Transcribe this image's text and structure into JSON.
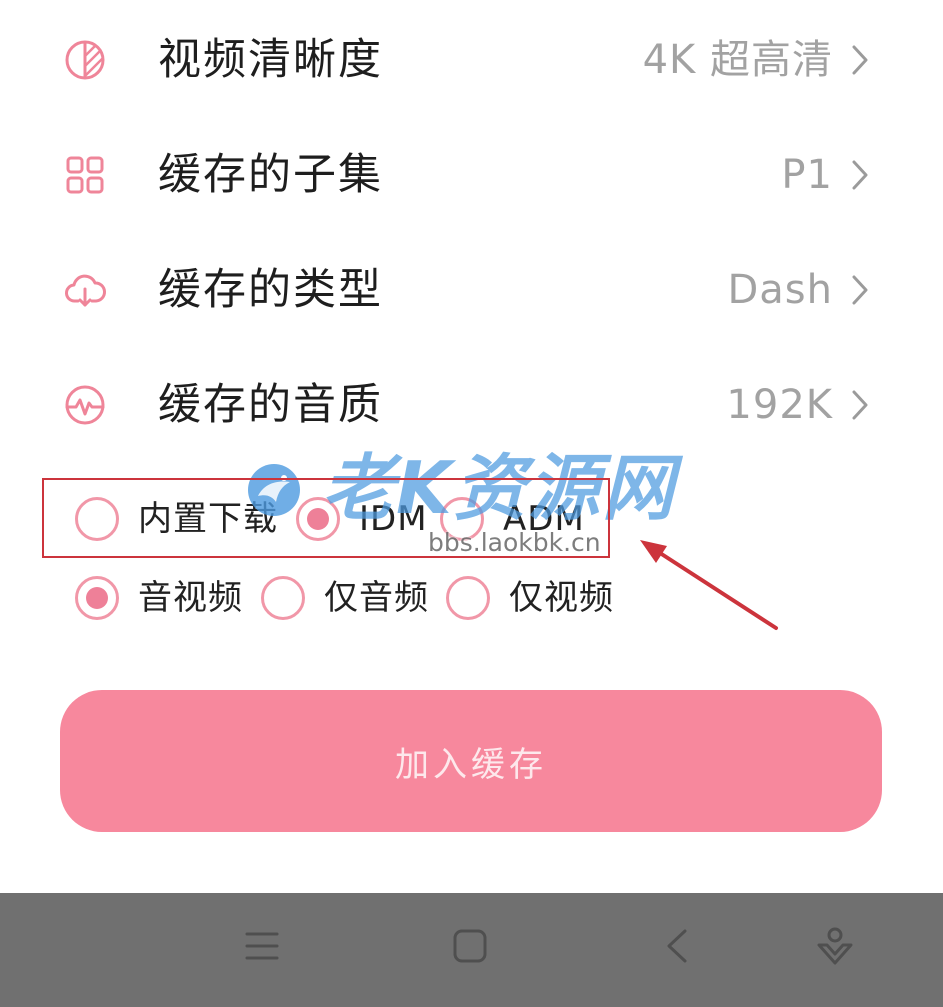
{
  "settings": {
    "rows": [
      {
        "icon": "resolution-icon",
        "label": "视频清晰度",
        "value": "4K 超高清"
      },
      {
        "icon": "grid-icon",
        "label": "缓存的子集",
        "value": "P1"
      },
      {
        "icon": "cloud-download-icon",
        "label": "缓存的类型",
        "value": "Dash"
      },
      {
        "icon": "audio-wave-icon",
        "label": "缓存的音质",
        "value": "192K"
      }
    ]
  },
  "downloader": {
    "options": [
      {
        "label": "内置下载",
        "selected": false
      },
      {
        "label": "IDM",
        "selected": true
      },
      {
        "label": "ADM",
        "selected": false
      }
    ]
  },
  "content_type": {
    "options": [
      {
        "label": "音视频",
        "selected": true
      },
      {
        "label": "仅音频",
        "selected": false
      },
      {
        "label": "仅视频",
        "selected": false
      }
    ]
  },
  "add_button": {
    "label": "加入缓存"
  },
  "watermark": {
    "name": "老K资源网",
    "url": "bbs.laokbk.cn"
  },
  "nav_bar": {
    "icons": [
      "menu-icon",
      "home-square-icon",
      "back-icon",
      "assistant-icon"
    ]
  },
  "colors": {
    "accent": "#ef8599",
    "accent_fill": "#ec6b87",
    "button": "#f7889d",
    "button_text": "#fde8ec",
    "text": "#1e1e1e",
    "muted": "#a2a2a2",
    "nav_bar": "#707070",
    "nav_icon": "#4f4f4f",
    "annotation": "#cc343c",
    "watermark": "#4d9be0"
  }
}
